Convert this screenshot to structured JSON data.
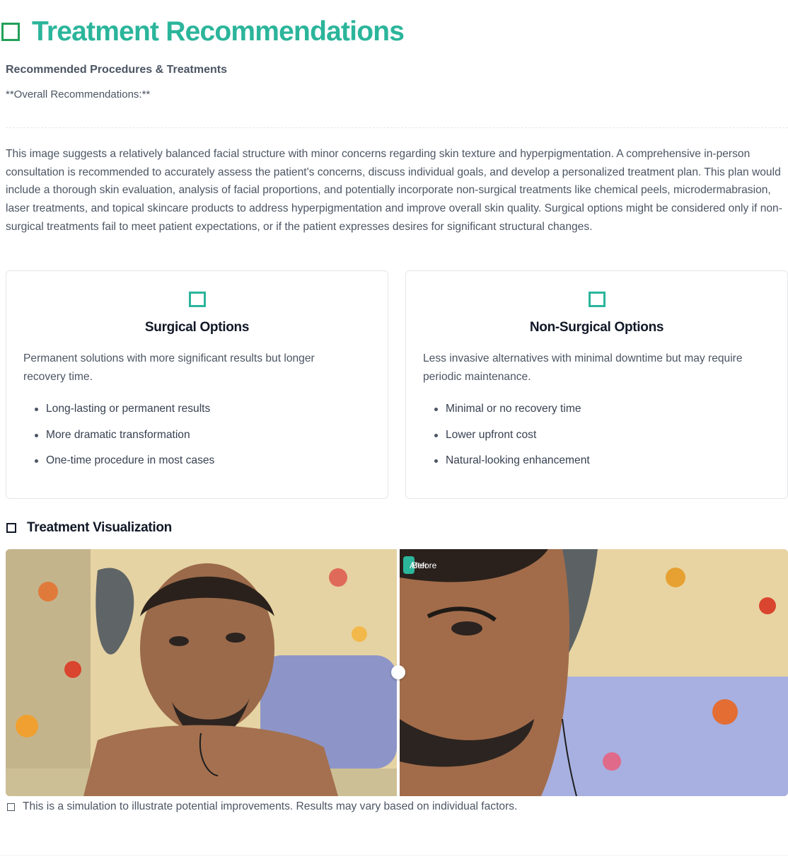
{
  "header": {
    "title": "Treatment Recommendations",
    "icon": "checkbox-square-icon",
    "accent_color": "#2bb59b"
  },
  "recommendations": {
    "subheading": "Recommended Procedures & Treatments",
    "overall_label": "**Overall Recommendations:**",
    "summary": "This image suggests a relatively balanced facial structure with minor concerns regarding skin texture and hyperpigmentation. A comprehensive in-person consultation is recommended to accurately assess the patient's concerns, discuss individual goals, and develop a personalized treatment plan. This plan would include a thorough skin evaluation, analysis of facial proportions, and potentially incorporate non-surgical treatments like chemical peels, microdermabrasion, laser treatments, and topical skincare products to address hyperpigmentation and improve overall skin quality. Surgical options might be considered only if non-surgical treatments fail to meet patient expectations, or if the patient expresses desires for significant structural changes."
  },
  "options": [
    {
      "icon": "surgical-icon",
      "title": "Surgical Options",
      "description": "Permanent solutions with more significant results but longer recovery time.",
      "points": [
        "Long-lasting or permanent results",
        "More dramatic transformation",
        "One-time procedure in most cases"
      ]
    },
    {
      "icon": "non-surgical-icon",
      "title": "Non-Surgical Options",
      "description": "Less invasive alternatives with minimal downtime but may require periodic maintenance.",
      "points": [
        "Minimal or no recovery time",
        "Lower upfront cost",
        "Natural-looking enhancement"
      ]
    }
  ],
  "visualization": {
    "title": "Treatment Visualization",
    "icon": "image-icon",
    "badge_after": "After",
    "badge_before": "Before",
    "slider_position": 0.5,
    "disclaimer": "This is a simulation to illustrate potential improvements. Results may vary based on individual factors."
  }
}
